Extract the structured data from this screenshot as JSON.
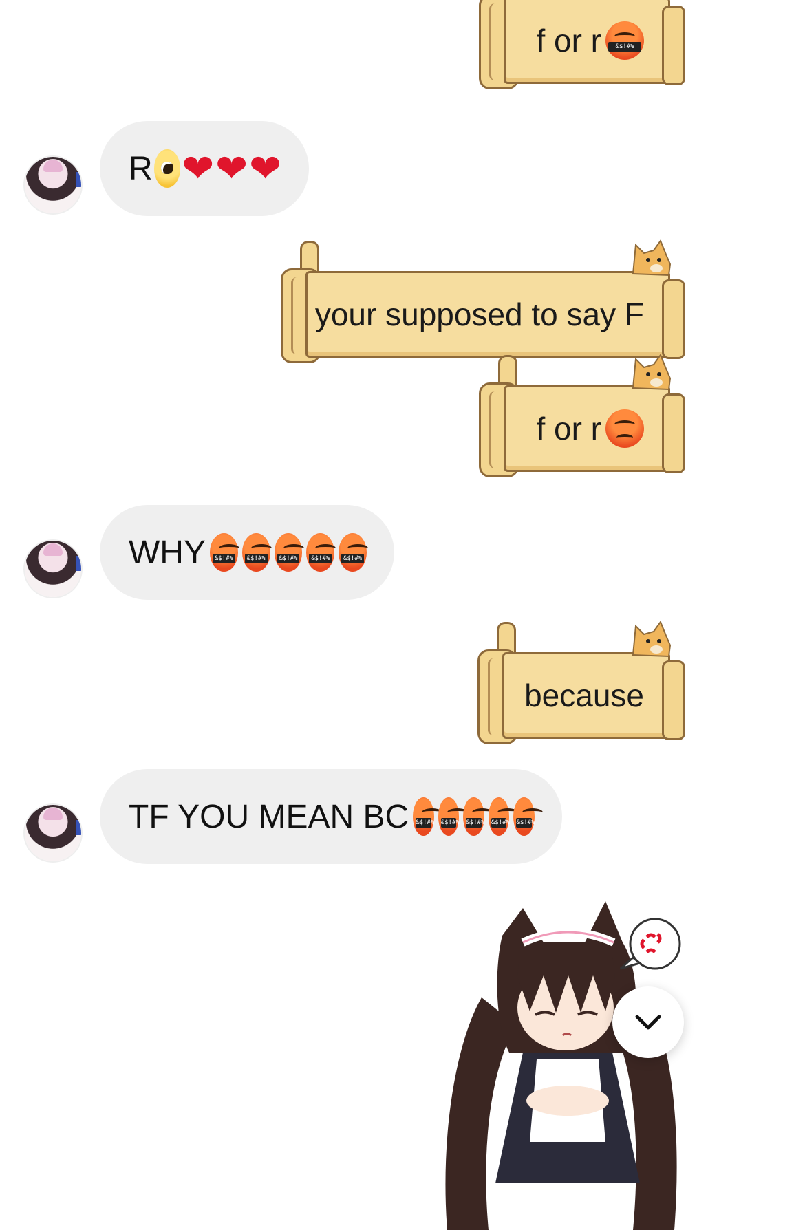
{
  "messages": [
    {
      "side": "out",
      "text": "f or r",
      "emoji": "cursing-face"
    },
    {
      "side": "in",
      "text": "R",
      "emoji": "pleading-face + 3 hearts"
    },
    {
      "side": "out",
      "text": "your supposed to say F"
    },
    {
      "side": "out",
      "text": "f or r",
      "emoji": "angry-face"
    },
    {
      "side": "in",
      "text": "WHY",
      "emoji": "5 cursing faces"
    },
    {
      "side": "out",
      "text": "because"
    },
    {
      "side": "in",
      "text": "TF YOU MEAN BC",
      "emoji": "5 cursing faces"
    }
  ],
  "icons": {
    "scroll_down": "chevron-down-icon",
    "sticker": "angry-catgirl-sticker"
  },
  "colors": {
    "incoming_bubble": "#efefef",
    "scroll_paper": "#f6dd9f",
    "scroll_border": "#8e6a3a"
  }
}
